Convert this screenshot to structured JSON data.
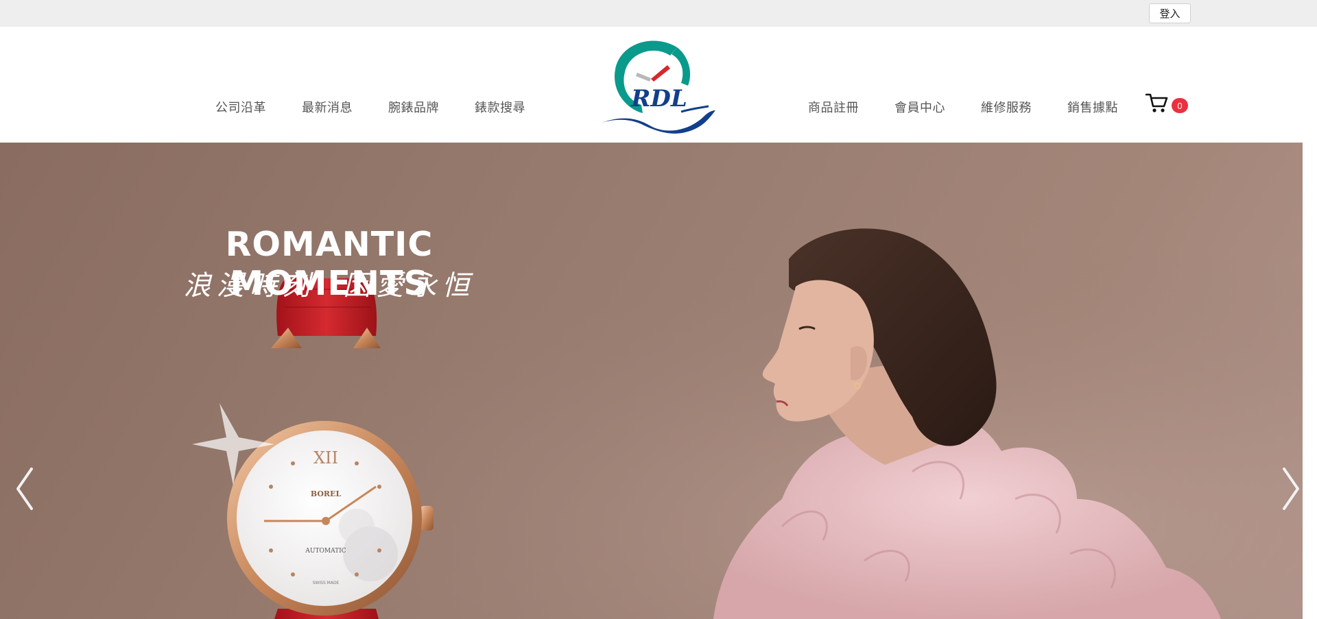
{
  "topbar": {
    "login_label": "登入"
  },
  "nav": {
    "left": [
      {
        "label": "公司沿革"
      },
      {
        "label": "最新消息"
      },
      {
        "label": "腕錶品牌"
      },
      {
        "label": "錶款搜尋"
      }
    ],
    "right": [
      {
        "label": "商品註冊"
      },
      {
        "label": "會員中心"
      },
      {
        "label": "維修服務"
      },
      {
        "label": "銷售據點"
      }
    ],
    "cart_count": "0"
  },
  "logo": {
    "text": "RDL",
    "colors": {
      "teal": "#0a9a8c",
      "navy": "#123f8c",
      "red": "#d8262e"
    }
  },
  "hero": {
    "headline": "ROMANTIC MOMENTS",
    "subheadline": "浪漫時刻  因愛永恒",
    "watch_dial_text": [
      "XII",
      "BOREL",
      "AUTOMATIC",
      "SWISS MADE"
    ],
    "background_color": "#967a6e"
  },
  "icons": {
    "cart": "shopping-cart-icon",
    "prev": "chevron-left-icon",
    "next": "chevron-right-icon"
  },
  "colors": {
    "badge": "#e8323f",
    "nav_text": "#555555",
    "topbar": "#eeeeee"
  }
}
